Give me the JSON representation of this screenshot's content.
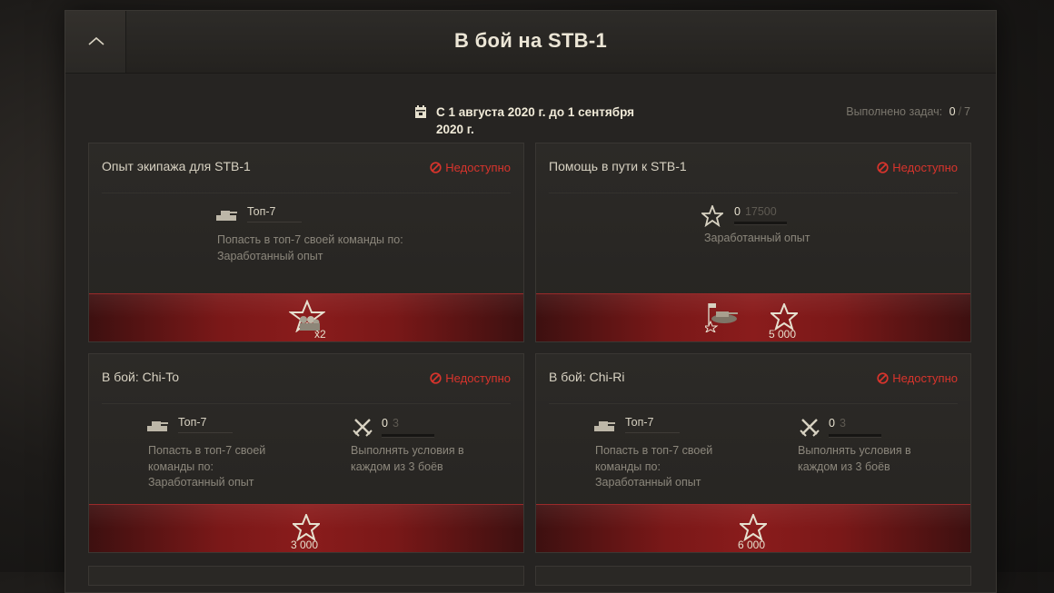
{
  "header": {
    "title": "В бой на STB-1"
  },
  "period": {
    "text": "С 1 августа 2020 г. до 1 сентября 2020 г."
  },
  "progress": {
    "label": "Выполнено задач:",
    "done": "0",
    "separator": "/",
    "total": "7"
  },
  "cards": [
    {
      "title": "Опыт экипажа для STB-1",
      "status": "Недоступно",
      "conditions": [
        {
          "icon": "tank-icon",
          "label": "Топ-7",
          "description": [
            "Попасть в топ-7 своей команды по:",
            "Заработанный опыт"
          ]
        }
      ],
      "reward": {
        "icon": "crew-star-icon",
        "value": "x2"
      }
    },
    {
      "title": "Помощь в пути к STB-1",
      "status": "Недоступно",
      "conditions": [
        {
          "icon": "star-icon",
          "current": "0",
          "total": "17500",
          "description": [
            "Заработанный опыт"
          ]
        }
      ],
      "reward": {
        "icons": [
          "tank-reward-icon",
          "star-icon"
        ],
        "value": "5 000"
      }
    },
    {
      "title": "В бой: Chi-To",
      "status": "Недоступно",
      "conditions": [
        {
          "icon": "tank-icon",
          "label": "Топ-7",
          "description": [
            "Попасть в топ-7 своей",
            "команды по:",
            "Заработанный опыт"
          ]
        },
        {
          "icon": "crossed-swords-icon",
          "current": "0",
          "total": "3",
          "description": [
            "Выполнять условия в",
            "каждом из 3 боёв"
          ]
        }
      ],
      "reward": {
        "icon": "star-icon",
        "value": "3 000"
      }
    },
    {
      "title": "В бой: Chi-Ri",
      "status": "Недоступно",
      "conditions": [
        {
          "icon": "tank-icon",
          "label": "Топ-7",
          "description": [
            "Попасть в топ-7 своей",
            "команды по:",
            "Заработанный опыт"
          ]
        },
        {
          "icon": "crossed-swords-icon",
          "current": "0",
          "total": "3",
          "description": [
            "Выполнять условия в",
            "каждом из 3 боёв"
          ]
        }
      ],
      "reward": {
        "icon": "star-icon",
        "value": "6 000"
      }
    }
  ],
  "colors": {
    "status_unavailable": "#d8342c",
    "reward_band": "#8a1c1c",
    "background": "#262422"
  }
}
